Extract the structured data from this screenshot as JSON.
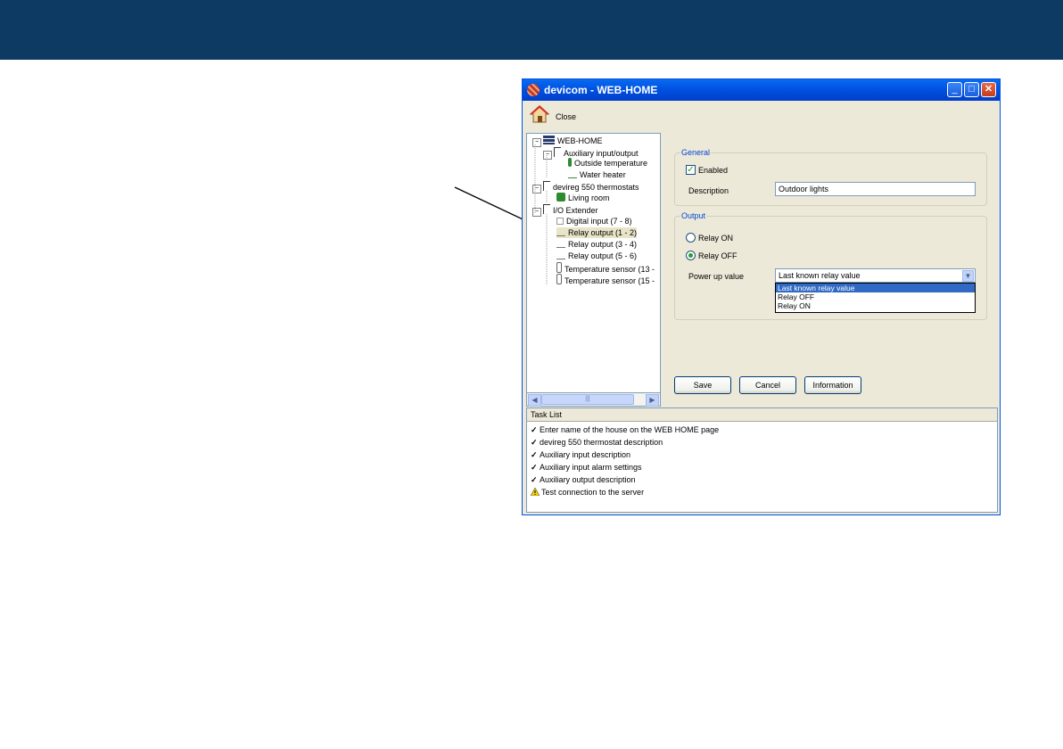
{
  "window": {
    "title": "devicom - WEB-HOME",
    "minimize": "_",
    "maximize": "□",
    "close": "✕"
  },
  "toolbar": {
    "close_label": "Close"
  },
  "tree": {
    "items": [
      {
        "label": "WEB-HOME",
        "icon": "server-icon"
      },
      {
        "label": "Auxiliary input/output",
        "icon": "network-icon"
      },
      {
        "label": "Outside temperature",
        "icon": "thermometer-icon"
      },
      {
        "label": "Water heater",
        "icon": "switch-icon"
      },
      {
        "label": "devireg 550 thermostats",
        "icon": "network-icon"
      },
      {
        "label": "Living room",
        "icon": "thermostat-icon"
      },
      {
        "label": "I/O Extender",
        "icon": "network-icon"
      },
      {
        "label": "Digital input (7 - 8)",
        "icon": "input-icon"
      },
      {
        "label": "Relay output (1 - 2)",
        "icon": "switch-icon",
        "selected": true
      },
      {
        "label": "Relay output (3 - 4)",
        "icon": "switch-icon"
      },
      {
        "label": "Relay output (5 - 6)",
        "icon": "switch-icon"
      },
      {
        "label": "Temperature sensor (13 -",
        "icon": "thermometer-icon"
      },
      {
        "label": "Temperature sensor (15 -",
        "icon": "thermometer-icon"
      }
    ]
  },
  "general": {
    "title": "General",
    "enabled_label": "Enabled",
    "enabled_checked": true,
    "description_label": "Description",
    "description_value": "Outdoor lights"
  },
  "output": {
    "title": "Output",
    "relay_on_label": "Relay ON",
    "relay_off_label": "Relay OFF",
    "selected": "Relay OFF",
    "power_up_label": "Power up value",
    "power_up_value": "Last known relay value",
    "options": [
      "Last known relay value",
      "Relay OFF",
      "Relay ON"
    ]
  },
  "buttons": {
    "save": "Save",
    "cancel": "Cancel",
    "information": "Information"
  },
  "tasklist": {
    "header": "Task List",
    "tasks": [
      {
        "text": "Enter name of the house on the WEB HOME page",
        "status": "done"
      },
      {
        "text": "devireg 550 thermostat description",
        "status": "done"
      },
      {
        "text": "Auxiliary input description",
        "status": "done"
      },
      {
        "text": "Auxiliary input alarm settings",
        "status": "done"
      },
      {
        "text": "Auxiliary output description",
        "status": "done"
      },
      {
        "text": "Test connection to the server",
        "status": "warning"
      }
    ]
  },
  "colors": {
    "header_bar": "#0c3a63",
    "xp_blue": "#0055e5",
    "selection": "#316ac5",
    "group_title": "#0046d5"
  }
}
